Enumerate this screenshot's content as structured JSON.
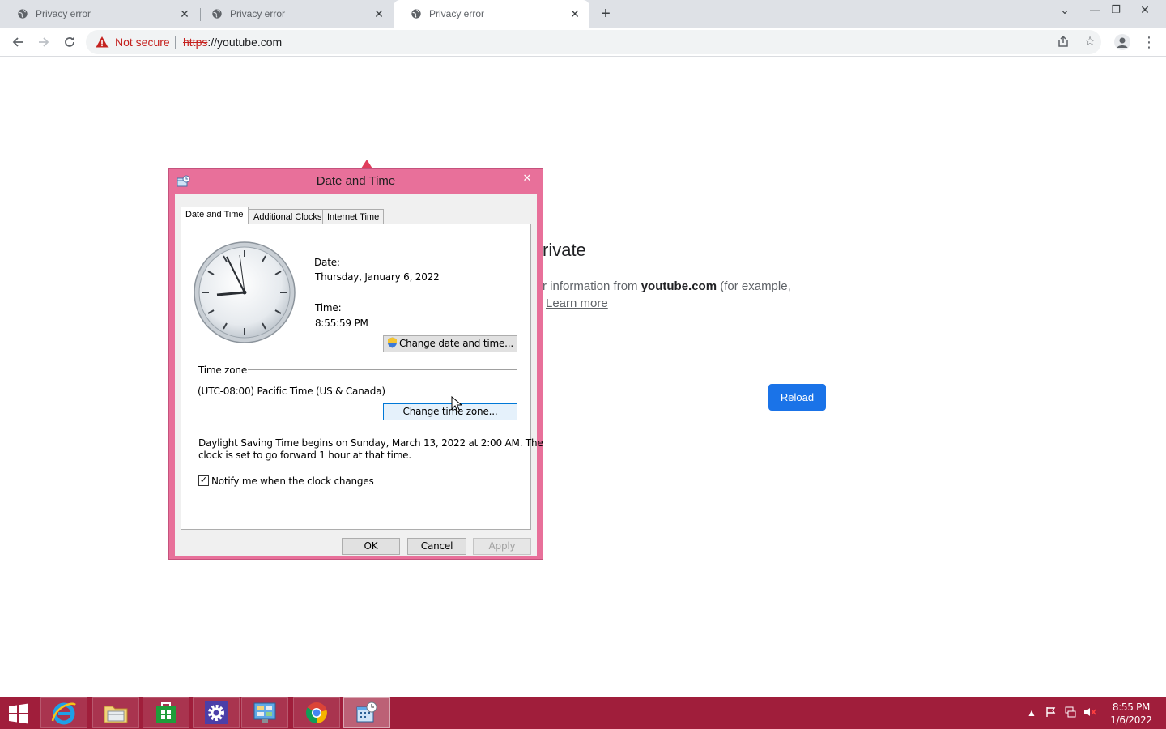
{
  "browser": {
    "tabs": [
      {
        "title": "Privacy error"
      },
      {
        "title": "Privacy error"
      },
      {
        "title": "Privacy error"
      }
    ],
    "security_label": "Not secure",
    "url_scheme": "https",
    "url_rest": "://youtube.com"
  },
  "page": {
    "heading_visible": "rivate",
    "body_prefix": "r information from ",
    "body_domain": "youtube.com",
    "body_suffix": " (for example,",
    "learn_more": "Learn more",
    "reload_label": "Reload"
  },
  "dialog": {
    "title": "Date and Time",
    "tabs": [
      "Date and Time",
      "Additional Clocks",
      "Internet Time"
    ],
    "date_label": "Date:",
    "date_value": "Thursday, January 6, 2022",
    "time_label": "Time:",
    "time_value": "8:55:59 PM",
    "change_datetime_button": "Change date and time...",
    "timezone_heading": "Time zone",
    "timezone_value": "(UTC-08:00) Pacific Time (US & Canada)",
    "change_timezone_button": "Change time zone...",
    "dst_line1": "Daylight Saving Time begins on Sunday, March 13, 2022 at 2:00 AM. The",
    "dst_line2": "clock is set to go forward 1 hour at that time.",
    "notify_label": "Notify me when the clock changes",
    "notify_checked": true,
    "ok_button": "OK",
    "cancel_button": "Cancel",
    "apply_button": "Apply"
  },
  "taskbar": {
    "clock_time": "8:55 PM",
    "clock_date": "1/6/2022",
    "pinned_icons": [
      "internet-explorer-icon",
      "file-explorer-icon",
      "store-icon",
      "settings-icon",
      "control-panel-icon",
      "chrome-icon",
      "date-time-icon"
    ]
  },
  "colors": {
    "taskbar": "#a01e3b",
    "dialog_frame": "#e8709a",
    "reload_button": "#1a73e8",
    "not_secure": "#c5221f"
  }
}
